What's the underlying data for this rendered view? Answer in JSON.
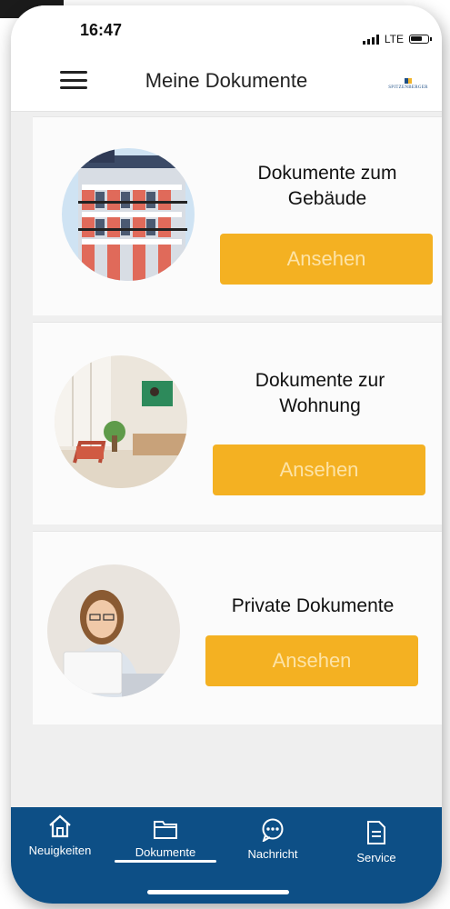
{
  "status_bar": {
    "time": "16:47",
    "network": "LTE"
  },
  "header": {
    "title": "Meine Dokumente",
    "logo_text": "SPITZENBERGER"
  },
  "cards": [
    {
      "title_line1": "Dokumente zum",
      "title_line2": "Gebäude",
      "button": "Ansehen",
      "image": "building-photo"
    },
    {
      "title_line1": "Dokumente zur",
      "title_line2": "Wohnung",
      "button": "Ansehen",
      "image": "living-room-photo"
    },
    {
      "title_line1": "Private Dokumente",
      "title_line2": "",
      "button": "Ansehen",
      "image": "woman-laptop-photo"
    }
  ],
  "tabs": [
    {
      "label": "Neuigkeiten",
      "icon": "home-icon"
    },
    {
      "label": "Dokumente",
      "icon": "folder-icon",
      "active": true
    },
    {
      "label": "Nachricht",
      "icon": "chat-icon"
    },
    {
      "label": "Service",
      "icon": "document-icon"
    }
  ],
  "colors": {
    "accent": "#f4b122",
    "tabbar": "#0d4f86",
    "background": "#efefef"
  }
}
